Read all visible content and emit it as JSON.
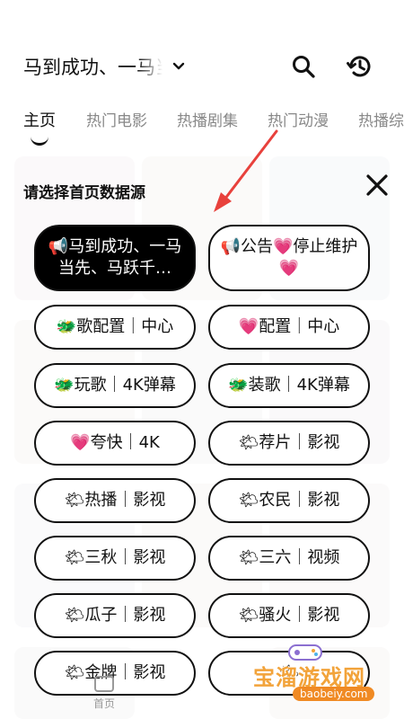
{
  "header": {
    "source_text": "马到成功、一马当先",
    "icons": {
      "chevron": "chevron-down-icon",
      "search": "search-icon",
      "history": "history-icon"
    }
  },
  "tabs": [
    {
      "label": "主页",
      "active": true
    },
    {
      "label": "热门电影",
      "active": false
    },
    {
      "label": "热播剧集",
      "active": false
    },
    {
      "label": "热门动漫",
      "active": false
    },
    {
      "label": "热播综",
      "active": false
    }
  ],
  "sheet": {
    "title": "请选择首页数据源",
    "close_icon": "close-icon",
    "options": [
      {
        "label": "📢马到成功、一马当先、马跃千…",
        "selected": true
      },
      {
        "label": "📢公告💗停止维护💗",
        "selected": false
      },
      {
        "label": "🐲歌配置｜中心",
        "selected": false
      },
      {
        "label": "💗配置｜中心",
        "selected": false
      },
      {
        "label": "🐲玩歌｜4K弹幕",
        "selected": false
      },
      {
        "label": "🐲装歌｜4K弹幕",
        "selected": false
      },
      {
        "label": "💗夸快｜4K",
        "selected": false
      },
      {
        "label": "🌤荐片｜影视",
        "selected": false
      },
      {
        "label": "🌤热播｜影视",
        "selected": false
      },
      {
        "label": "🌤农民｜影视",
        "selected": false
      },
      {
        "label": "🌤三秋｜影视",
        "selected": false
      },
      {
        "label": "🌤三六｜视频",
        "selected": false
      },
      {
        "label": "🌤瓜子｜影视",
        "selected": false
      },
      {
        "label": "🌤骚火｜影视",
        "selected": false
      },
      {
        "label": "🌤金牌｜影视",
        "selected": false
      },
      {
        "label": "🌤",
        "selected": false
      }
    ]
  },
  "bottom_nav": {
    "home_label": "首页"
  },
  "watermark": {
    "text": "宝溜游戏网",
    "url": "baobeiy.com"
  },
  "colors": {
    "accent_arrow": "#e8413c",
    "selected_bg": "#000000",
    "watermark": "#f2a33a"
  }
}
